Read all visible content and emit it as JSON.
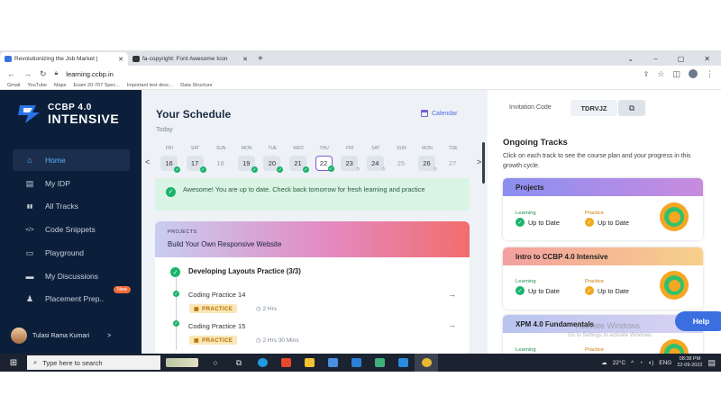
{
  "browser": {
    "tabs": [
      {
        "title": "Revolutionizing the Job Market | ",
        "close": "✕",
        "favicon_color": "#3b6fe0"
      },
      {
        "title": "fa-copyright: Font Awesome Icon",
        "close": "✕",
        "favicon_color": "#333333"
      }
    ],
    "new_tab": "+",
    "window_controls": [
      "⌄",
      "−",
      "▢",
      "✕"
    ],
    "url": "learning.ccbp.in",
    "bookmarks": [
      "Gmail",
      "YouTube",
      "Maps",
      "Exam 20-707 Spec...",
      "Important test desc...",
      "Data Structure"
    ]
  },
  "sidebar": {
    "logo_line1": "CCBP 4.0",
    "logo_line2": "INTENSIVE",
    "items": [
      {
        "label": "Home",
        "icon": "home-icon",
        "glyph": "⌂"
      },
      {
        "label": "My IDP",
        "icon": "document-icon",
        "glyph": "▤"
      },
      {
        "label": "All Tracks",
        "icon": "tracks-icon",
        "glyph": "▮▮"
      },
      {
        "label": "Code Snippets",
        "icon": "code-icon",
        "glyph": "</>"
      },
      {
        "label": "Playground",
        "icon": "terminal-icon",
        "glyph": "▭"
      },
      {
        "label": "My Discussions",
        "icon": "discussion-icon",
        "glyph": "▬"
      },
      {
        "label": "Placement Prep..",
        "icon": "person-icon",
        "glyph": "♟"
      }
    ],
    "new_badge": "New",
    "user_name": "Tulasi Rama Kumari",
    "user_chevron": ">"
  },
  "schedule": {
    "title": "Your Schedule",
    "subtitle": "Today",
    "calendar_label": "Calendar",
    "prev": "<",
    "next": ">",
    "days": [
      {
        "dow": "FRI",
        "num": "16",
        "state": "done"
      },
      {
        "dow": "SAT",
        "num": "17",
        "state": "done"
      },
      {
        "dow": "SUN",
        "num": "18",
        "state": "past"
      },
      {
        "dow": "MON",
        "num": "19",
        "state": "done"
      },
      {
        "dow": "TUE",
        "num": "20",
        "state": "done"
      },
      {
        "dow": "WED",
        "num": "21",
        "state": "done"
      },
      {
        "dow": "THU",
        "num": "22",
        "state": "selected"
      },
      {
        "dow": "FRI",
        "num": "23",
        "state": "pending"
      },
      {
        "dow": "SAT",
        "num": "24",
        "state": "pending"
      },
      {
        "dow": "SUN",
        "num": "25",
        "state": "future"
      },
      {
        "dow": "MON",
        "num": "26",
        "state": "pending"
      },
      {
        "dow": "TUE",
        "num": "27",
        "state": "future"
      }
    ],
    "banner": "Awesome! You are up to date. Check back tomorrow for fresh learning and practice",
    "project": {
      "tag": "PROJECTS",
      "title": "Build Your Own Responsive Website",
      "subsection": "Developing Layouts Practice (3/3)",
      "items": [
        {
          "name": "Coding Practice 14",
          "tag": "PRACTICE",
          "duration": "2 Hrs"
        },
        {
          "name": "Coding Practice 15",
          "tag": "PRACTICE",
          "duration": "2 Hrs 30 Mins"
        }
      ]
    }
  },
  "right": {
    "invitation_label": "Invitation Code",
    "invitation_code": "TDRVJZ",
    "ongoing_title": "Ongoing Tracks",
    "ongoing_desc": "Click on each track to see the course plan and your progress in this growth cycle.",
    "tracks": [
      {
        "title": "Projects",
        "learning_label": "Learning",
        "learning_value": "Up to Date",
        "practice_label": "Practice",
        "practice_value": "Up to Date",
        "header_colors": [
          "#8a8ff0",
          "#c98be0"
        ]
      },
      {
        "title": "Intro to CCBP 4.0 Intensive",
        "learning_label": "Learning",
        "learning_value": "Up to Date",
        "practice_label": "Practice",
        "practice_value": "Up to Date",
        "header_colors": [
          "#f3a0a0",
          "#f7d08a"
        ]
      },
      {
        "title": "XPM 4.0 Fundamentals",
        "learning_label": "Learning",
        "learning_value": "",
        "practice_label": "Practice",
        "practice_value": "",
        "header_colors": [
          "#b9c4ef",
          "#d9d2f2"
        ]
      }
    ],
    "help": "Help",
    "watermark1": "Activate Windows",
    "watermark2": "Go to Settings to activate Windows."
  },
  "taskbar": {
    "search_placeholder": "Type here to search",
    "weather": "22°C",
    "lang": "ENG",
    "time": "08:38 PM",
    "date": "22-09-2022"
  }
}
